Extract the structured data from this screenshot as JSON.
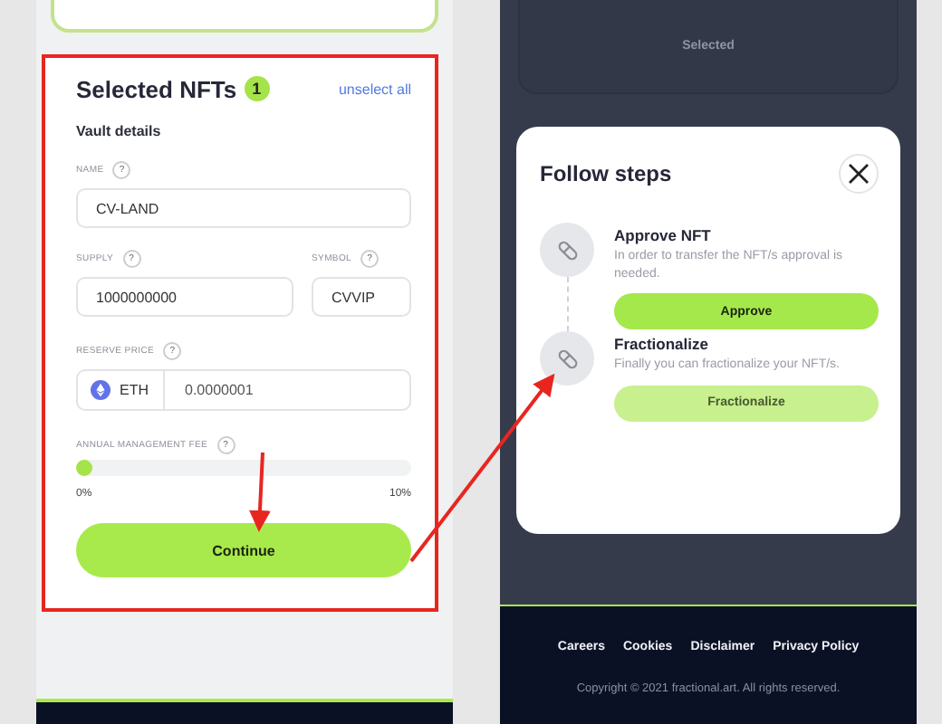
{
  "left_panel": {
    "vault_form": {
      "title": "Selected NFTs",
      "count": "1",
      "unselect_link": "unselect all",
      "section": "Vault details",
      "name_field": {
        "label": "NAME",
        "help": "?",
        "value": "CV-LAND"
      },
      "supply_field": {
        "label": "SUPPLY",
        "help": "?",
        "value": "1000000000"
      },
      "symbol_field": {
        "label": "SYMBOL",
        "help": "?",
        "value": "CVVIP"
      },
      "reserve_price": {
        "label": "RESERVE PRICE",
        "help": "?",
        "currency": "ETH",
        "value": "0.0000001"
      },
      "management_fee": {
        "label": "ANNUAL MANAGEMENT FEE",
        "help": "?",
        "level": 0,
        "min_label": "0%",
        "max_label": "10%"
      },
      "continue_button": "Continue"
    }
  },
  "right_panel": {
    "background_card": {
      "label": "Selected"
    },
    "modal": {
      "title": "Follow steps",
      "steps": [
        {
          "title": "Approve NFT",
          "description": "In order to transfer the NFT/s approval is needed.",
          "button": "Approve",
          "disabled": false
        },
        {
          "title": "Fractionalize",
          "description": "Finally you can fractionalize your NFT/s.",
          "button": "Fractionalize",
          "disabled": true
        }
      ]
    },
    "footer": {
      "links": [
        "Careers",
        "Cookies",
        "Disclaimer",
        "Privacy Policy"
      ],
      "copyright": "Copyright © 2021 fractional.art. All rights reserved."
    }
  }
}
